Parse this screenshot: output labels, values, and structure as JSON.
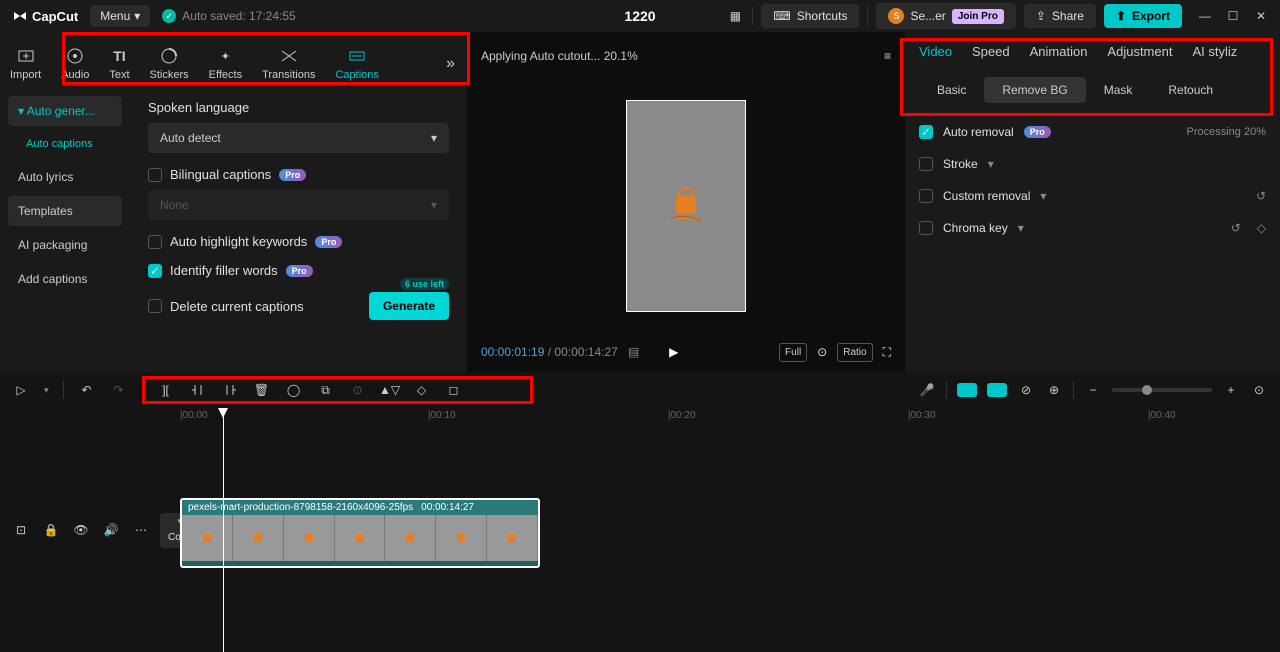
{
  "header": {
    "app_name": "CapCut",
    "menu_label": "Menu",
    "auto_save": "Auto saved: 17:24:55",
    "center_number": "1220",
    "shortcuts": "Shortcuts",
    "user_label": "Se...er",
    "join_pro": "Join Pro",
    "share": "Share",
    "export": "Export"
  },
  "media_tabs": {
    "import": "Import",
    "audio": "Audio",
    "text": "Text",
    "stickers": "Stickers",
    "effects": "Effects",
    "transitions": "Transitions",
    "captions": "Captions"
  },
  "sidebar": {
    "auto_gen": "Auto gener...",
    "auto_captions": "Auto captions",
    "auto_lyrics": "Auto lyrics",
    "templates": "Templates",
    "ai_packaging": "AI packaging",
    "add_captions": "Add captions"
  },
  "captions_form": {
    "spoken_lang_label": "Spoken language",
    "spoken_lang_value": "Auto detect",
    "bilingual": "Bilingual captions",
    "bilingual_placeholder": "None",
    "highlight": "Auto highlight keywords",
    "filler": "Identify filler words",
    "delete_current": "Delete current captions",
    "generate": "Generate",
    "use_left": "6 use left",
    "pro": "Pro"
  },
  "preview": {
    "status": "Applying Auto cutout... 20.1%",
    "current_time": "00:00:01:19",
    "duration": "00:00:14:27",
    "full": "Full",
    "ratio": "Ratio"
  },
  "right": {
    "tabs": {
      "video": "Video",
      "speed": "Speed",
      "animation": "Animation",
      "adjustment": "Adjustment",
      "ai_styliz": "AI styliz"
    },
    "sub": {
      "basic": "Basic",
      "remove_bg": "Remove BG",
      "mask": "Mask",
      "retouch": "Retouch"
    },
    "auto_removal": "Auto removal",
    "processing": "Processing 20%",
    "stroke": "Stroke",
    "custom_removal": "Custom removal",
    "chroma_key": "Chroma key",
    "pro": "Pro"
  },
  "timeline": {
    "cover": "Cover",
    "clip_name": "pexels-mart-production-8798158-2160x4096-25fps",
    "clip_duration": "00:00:14:27",
    "marks": [
      "|00:00",
      "|00:10",
      "|00:20",
      "|00:30",
      "|00:40"
    ]
  }
}
